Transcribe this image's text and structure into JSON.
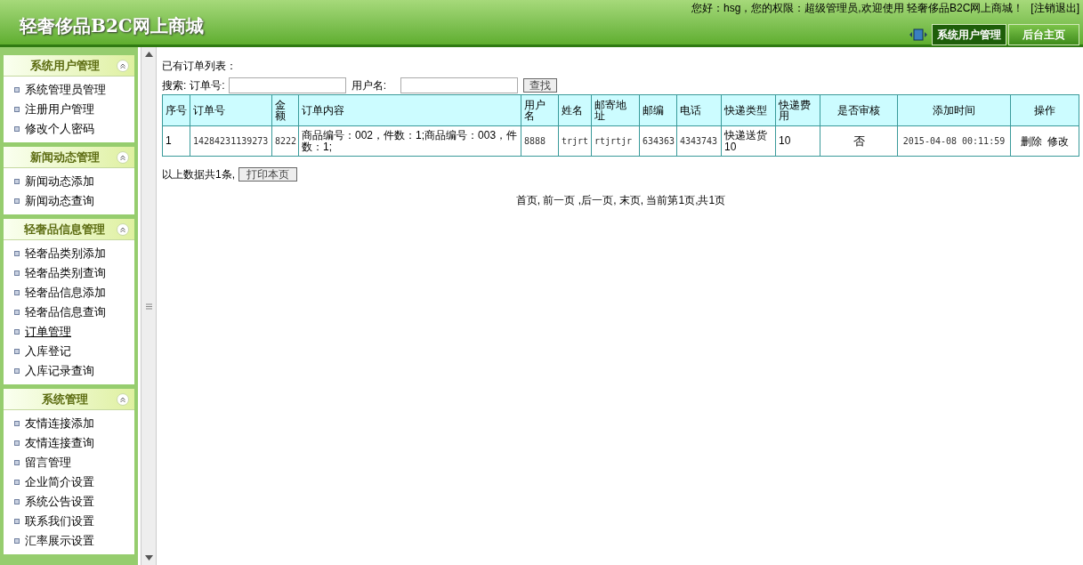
{
  "header": {
    "title": "轻奢侈品B2C网上商城",
    "welcome": "您好：hsg，您的权限：超级管理员,欢迎使用 轻奢侈品B2C网上商城！",
    "logout": "[注销退出]",
    "tabs": [
      {
        "label": "系统用户管理",
        "selected": true
      },
      {
        "label": "后台主页",
        "selected": false
      }
    ]
  },
  "sidebar": {
    "sections": [
      {
        "title": "系统用户管理",
        "expanded": true,
        "items": [
          {
            "label": "系统管理员管理",
            "selected": false
          },
          {
            "label": "注册用户管理",
            "selected": false
          },
          {
            "label": "修改个人密码",
            "selected": false
          }
        ]
      },
      {
        "title": "新闻动态管理",
        "expanded": true,
        "items": [
          {
            "label": "新闻动态添加",
            "selected": false
          },
          {
            "label": "新闻动态查询",
            "selected": false
          }
        ]
      },
      {
        "title": "轻奢品信息管理",
        "expanded": true,
        "items": [
          {
            "label": "轻奢品类别添加",
            "selected": false
          },
          {
            "label": "轻奢品类别查询",
            "selected": false
          },
          {
            "label": "轻奢品信息添加",
            "selected": false
          },
          {
            "label": "轻奢品信息查询",
            "selected": false
          },
          {
            "label": "订单管理",
            "selected": true
          },
          {
            "label": "入库登记",
            "selected": false
          },
          {
            "label": "入库记录查询",
            "selected": false
          }
        ]
      },
      {
        "title": "系统管理",
        "expanded": true,
        "items": [
          {
            "label": "友情连接添加",
            "selected": false
          },
          {
            "label": "友情连接查询",
            "selected": false
          },
          {
            "label": "留言管理",
            "selected": false
          },
          {
            "label": "企业简介设置",
            "selected": false
          },
          {
            "label": "系统公告设置",
            "selected": false
          },
          {
            "label": "联系我们设置",
            "selected": false
          },
          {
            "label": "汇率展示设置",
            "selected": false
          }
        ]
      }
    ]
  },
  "main": {
    "heading": "已有订单列表：",
    "search": {
      "label": "搜索:",
      "order_label": "订单号:",
      "user_label": "用户名:",
      "button": "查找"
    },
    "table": {
      "columns": [
        "序号",
        "订单号",
        "金额",
        "订单内容",
        "用户名",
        "姓名",
        "邮寄地址",
        "邮编",
        "电话",
        "快递类型",
        "快递费用",
        "是否审核",
        "添加时间",
        "操作"
      ],
      "rows": [
        {
          "cells": [
            "1",
            "14284231139273",
            "8222",
            "商品编号：002，件数：1;商品编号：003，件数：1;",
            "8888",
            "trjrt",
            "rtjrtjr",
            "634363",
            "4343743",
            "快递送货10",
            "10",
            "否",
            "2015-04-08 00:11:59"
          ],
          "actions": [
            "删除",
            "修改"
          ]
        }
      ]
    },
    "summary": "以上数据共1条,",
    "print_button": "打印本页",
    "pagination": "首页, 前一页 ,后一页, 末页, 当前第1页,共1页"
  }
}
